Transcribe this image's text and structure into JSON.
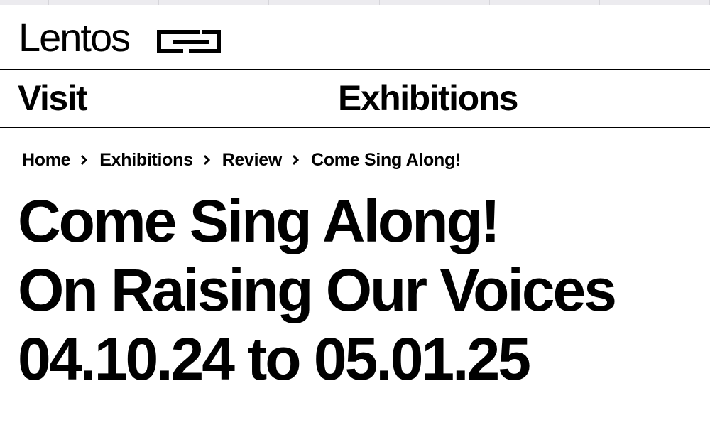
{
  "header": {
    "logo_text": "Lentos",
    "logo_mark_icon": "lentos-logo-mark-icon"
  },
  "nav": {
    "items": [
      {
        "label": "Visit"
      },
      {
        "label": "Exhibitions"
      }
    ]
  },
  "breadcrumb": {
    "items": [
      {
        "label": "Home"
      },
      {
        "label": "Exhibitions"
      },
      {
        "label": "Review"
      },
      {
        "label": "Come Sing Along!"
      }
    ],
    "separator_icon": "chevron-right-icon"
  },
  "page": {
    "title_line1": "Come Sing Along!",
    "title_line2": "On Raising Our Voices",
    "date_range": "04.10.24 to 05.01.25"
  },
  "colors": {
    "text": "#000000",
    "background": "#ffffff",
    "top_strip": "#ecebef"
  }
}
